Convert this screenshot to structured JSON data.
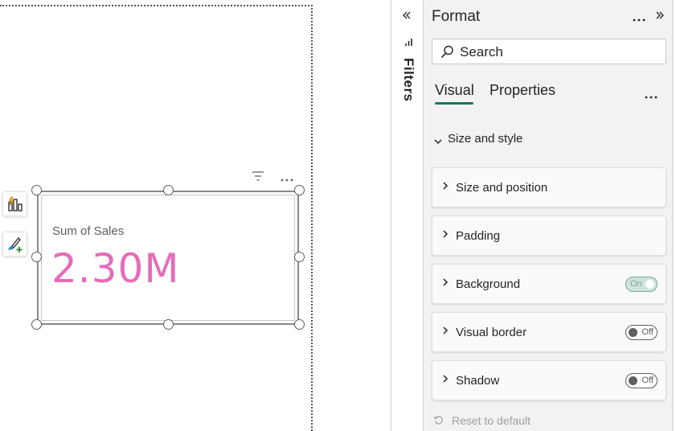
{
  "canvas": {
    "card_visual": {
      "label": "Sum of Sales",
      "value": "2.30M",
      "value_color": "#e66cbb"
    }
  },
  "filters": {
    "label": "Filters"
  },
  "format_pane": {
    "title": "Format",
    "search": {
      "placeholder": "Search"
    },
    "tabs": [
      {
        "label": "Visual",
        "active": true
      },
      {
        "label": "Properties",
        "active": false
      }
    ],
    "section": {
      "label": "Size and style"
    },
    "cards": [
      {
        "label": "Size and position"
      },
      {
        "label": "Padding"
      },
      {
        "label": "Background",
        "toggle": "On"
      },
      {
        "label": "Visual border",
        "toggle": "Off"
      },
      {
        "label": "Shadow",
        "toggle": "Off"
      }
    ],
    "reset_label": "Reset to default"
  },
  "colors": {
    "accent": "#117865",
    "card_value": "#e66cbb"
  }
}
